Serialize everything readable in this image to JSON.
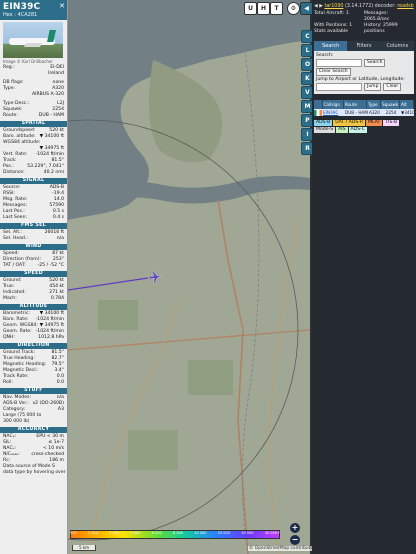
{
  "flight": {
    "callsign": "EIN39C",
    "hex_line": "Hex : 4CA281",
    "close": "✕",
    "photo_credit": "Image © Karl Drillbacher",
    "reg_label": "Reg.:",
    "reg": "EI-DEI",
    "country": "Ireland",
    "db_flags_label": "DB flags:",
    "db_flags": "none",
    "type_label": "Type:",
    "type": "A320",
    "type_name": "AIRBUS A-320",
    "type_desc_label": "Type Desc.:",
    "type_desc": "L2J",
    "squawk_label": "Squawk:",
    "squawk": "2254",
    "route_label": "Route:",
    "route": "DUB - HAM"
  },
  "spatial": {
    "title": "SPATIAL",
    "rows": [
      {
        "k": "Groundspeed:",
        "v": "520 kt"
      },
      {
        "k": "Baro. altitude:",
        "v": "▼ 34100 ft"
      },
      {
        "k": "WGS84 altitude:",
        "v": ""
      },
      {
        "k": "",
        "v": "▼ 34975 ft"
      },
      {
        "k": "Vert. Rate:",
        "v": "-1024 ft/min"
      },
      {
        "k": "Track:",
        "v": "81.5°"
      },
      {
        "k": "Pos.:",
        "v": "53.229°, 7.041°"
      },
      {
        "k": "Distance:",
        "v": "40.2 nmi"
      }
    ]
  },
  "signal": {
    "title": "SIGNAL",
    "rows": [
      {
        "k": "Source:",
        "v": "ADS-B"
      },
      {
        "k": "RSSI:",
        "v": "-19.4"
      },
      {
        "k": "Msg. Rate:",
        "v": "14.0"
      },
      {
        "k": "Messages:",
        "v": "57590"
      },
      {
        "k": "Last Pos.:",
        "v": "0.5 s"
      },
      {
        "k": "Last Seen:",
        "v": "0.4 s"
      }
    ]
  },
  "fms": {
    "title": "FMS SEL",
    "rows": [
      {
        "k": "Sel. Alt.:",
        "v": "26016 ft"
      },
      {
        "k": "Sel. Head.:",
        "v": "n/a"
      }
    ]
  },
  "wind": {
    "title": "WIND",
    "rows": [
      {
        "k": "Speed:",
        "v": "87 kt"
      },
      {
        "k": "Direction (from):",
        "v": "253°"
      },
      {
        "k": "TAT / OAT:",
        "v": "-25 / -52 °C"
      }
    ]
  },
  "speed": {
    "title": "SPEED",
    "rows": [
      {
        "k": "Ground:",
        "v": "520 kt"
      },
      {
        "k": "True:",
        "v": "454 kt"
      },
      {
        "k": "Indicated:",
        "v": "271 kt"
      },
      {
        "k": "Mach:",
        "v": "0.784"
      }
    ]
  },
  "altitude": {
    "title": "ALTITUDE",
    "rows": [
      {
        "k": "Barometric:",
        "v": "▼ 34100 ft"
      },
      {
        "k": "Baro. Rate:",
        "v": "-1024 ft/min"
      },
      {
        "k": "Geom. WGS84:",
        "v": "▼ 34975 ft"
      },
      {
        "k": "Geom. Rate:",
        "v": "-1024 ft/min"
      },
      {
        "k": "QNH:",
        "v": "1012.8 hPa"
      }
    ]
  },
  "direction": {
    "title": "DIRECTION",
    "rows": [
      {
        "k": "Ground Track:",
        "v": "81.5°"
      },
      {
        "k": "True Heading:",
        "v": "82.7°"
      },
      {
        "k": "Magnetic Heading:",
        "v": "79.5°"
      },
      {
        "k": "Magnetic Decl.:",
        "v": "3.4°"
      },
      {
        "k": "Track Rate:",
        "v": "0.0"
      },
      {
        "k": "Roll:",
        "v": "0.0"
      }
    ]
  },
  "stuff": {
    "title": "STUFF",
    "rows": [
      {
        "k": "Nav. Modes:",
        "v": "n/a"
      },
      {
        "k": "ADS-B Ver.:",
        "v": "v2 (DO-260B)"
      },
      {
        "k": "Category:",
        "v": "A3"
      },
      {
        "k": "Large (75 000 to",
        "v": ""
      },
      {
        "k": "300 000 lb)",
        "v": ""
      }
    ]
  },
  "accuracy": {
    "title": "ACCURACY",
    "rows": [
      {
        "k": "NACₚ:",
        "v": "EPU < 30 m"
      },
      {
        "k": "SIL:",
        "v": "≤ 1e-7"
      },
      {
        "k": "NACᵥ:",
        "v": "< 10 m/s"
      },
      {
        "k": "NICₐₐₐₐ:",
        "v": "cross-checked"
      },
      {
        "k": "Rc:",
        "v": "186 m"
      }
    ]
  },
  "footer_note": {
    "line1": "Data source of Mode S",
    "line2": "data type by hovering over"
  },
  "map": {
    "top_buttons": [
      "U",
      "H",
      "T"
    ],
    "side_buttons": [
      "C",
      "L",
      "O",
      "K",
      "V",
      "M",
      "P",
      "I",
      "R"
    ],
    "zoom_in": "+",
    "zoom_out": "−",
    "altitude_ticks": [
      "500",
      "1 000",
      "2 000",
      "4 000",
      "6 000",
      "8 000",
      "10 000",
      "20 000",
      "30 000",
      "40 000+"
    ],
    "scale_label": "5 km",
    "attribution": "© OpenStreetMap contributors."
  },
  "right_panel": {
    "version_prefix": "◀ ▶ ",
    "version_link": "tar1090",
    "version_rest": " (3.14.1772) decoder: ",
    "decoder_link": "readsb",
    "total_aircraft_label": "Total Aircraft:",
    "total_aircraft": "1",
    "with_positions_label": "With Positions:",
    "with_positions": "1",
    "stats_available": "Stats available",
    "messages_label": "Messages:",
    "messages": "2065.8/sec",
    "history_label": "History:",
    "history": "25999 positions",
    "tabs": [
      "Search",
      "Filters",
      "Columns"
    ],
    "search_label": "Search:",
    "search_button": "Search",
    "clear_search": "Clear Search",
    "jump_label": "Jump to Airport or Latitude, Longitude:",
    "jump_button": "Jump",
    "clear_button": "Clear",
    "columns": [
      "Callsign",
      "Route",
      "Type",
      "Squawk",
      "Alt"
    ],
    "row": {
      "flag": "IE",
      "callsign": "EIN39C",
      "route": "DUB - HAM",
      "type": "A320",
      "squawk": "2254",
      "alt": "▼34100"
    },
    "badges": [
      {
        "text": "ADS-B",
        "bg": "#8dd3f0"
      },
      {
        "text": "UAT / ADS-R",
        "bg": "#f4c542"
      },
      {
        "text": "MLAT",
        "bg": "#f28e4f"
      },
      {
        "text": "TIS-B",
        "bg": "#f5d6ff"
      },
      {
        "text": "Mode-S",
        "bg": "#dddddd"
      },
      {
        "text": "AIS",
        "bg": "#c9f0c0"
      },
      {
        "text": "ADS-C",
        "bg": "#c7f2e8"
      }
    ]
  },
  "colors": {
    "accent": "#2c6e8a",
    "track": "#7a3cff",
    "water": "#9aa9b6",
    "land": "#cdd4bd"
  }
}
